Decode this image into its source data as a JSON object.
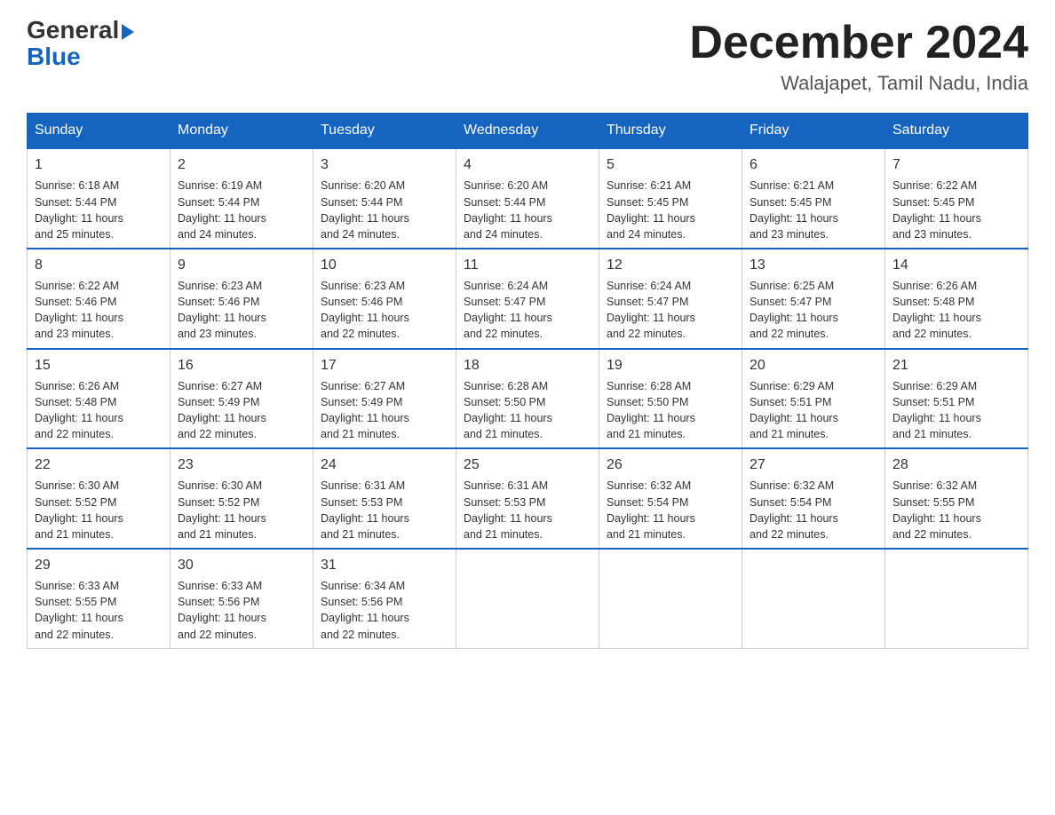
{
  "header": {
    "logo_line1": "General",
    "logo_line2": "Blue",
    "month_title": "December 2024",
    "location": "Walajapet, Tamil Nadu, India"
  },
  "days_of_week": [
    "Sunday",
    "Monday",
    "Tuesday",
    "Wednesday",
    "Thursday",
    "Friday",
    "Saturday"
  ],
  "weeks": [
    [
      {
        "day": 1,
        "info": "Sunrise: 6:18 AM\nSunset: 5:44 PM\nDaylight: 11 hours\nand 25 minutes."
      },
      {
        "day": 2,
        "info": "Sunrise: 6:19 AM\nSunset: 5:44 PM\nDaylight: 11 hours\nand 24 minutes."
      },
      {
        "day": 3,
        "info": "Sunrise: 6:20 AM\nSunset: 5:44 PM\nDaylight: 11 hours\nand 24 minutes."
      },
      {
        "day": 4,
        "info": "Sunrise: 6:20 AM\nSunset: 5:44 PM\nDaylight: 11 hours\nand 24 minutes."
      },
      {
        "day": 5,
        "info": "Sunrise: 6:21 AM\nSunset: 5:45 PM\nDaylight: 11 hours\nand 24 minutes."
      },
      {
        "day": 6,
        "info": "Sunrise: 6:21 AM\nSunset: 5:45 PM\nDaylight: 11 hours\nand 23 minutes."
      },
      {
        "day": 7,
        "info": "Sunrise: 6:22 AM\nSunset: 5:45 PM\nDaylight: 11 hours\nand 23 minutes."
      }
    ],
    [
      {
        "day": 8,
        "info": "Sunrise: 6:22 AM\nSunset: 5:46 PM\nDaylight: 11 hours\nand 23 minutes."
      },
      {
        "day": 9,
        "info": "Sunrise: 6:23 AM\nSunset: 5:46 PM\nDaylight: 11 hours\nand 23 minutes."
      },
      {
        "day": 10,
        "info": "Sunrise: 6:23 AM\nSunset: 5:46 PM\nDaylight: 11 hours\nand 22 minutes."
      },
      {
        "day": 11,
        "info": "Sunrise: 6:24 AM\nSunset: 5:47 PM\nDaylight: 11 hours\nand 22 minutes."
      },
      {
        "day": 12,
        "info": "Sunrise: 6:24 AM\nSunset: 5:47 PM\nDaylight: 11 hours\nand 22 minutes."
      },
      {
        "day": 13,
        "info": "Sunrise: 6:25 AM\nSunset: 5:47 PM\nDaylight: 11 hours\nand 22 minutes."
      },
      {
        "day": 14,
        "info": "Sunrise: 6:26 AM\nSunset: 5:48 PM\nDaylight: 11 hours\nand 22 minutes."
      }
    ],
    [
      {
        "day": 15,
        "info": "Sunrise: 6:26 AM\nSunset: 5:48 PM\nDaylight: 11 hours\nand 22 minutes."
      },
      {
        "day": 16,
        "info": "Sunrise: 6:27 AM\nSunset: 5:49 PM\nDaylight: 11 hours\nand 22 minutes."
      },
      {
        "day": 17,
        "info": "Sunrise: 6:27 AM\nSunset: 5:49 PM\nDaylight: 11 hours\nand 21 minutes."
      },
      {
        "day": 18,
        "info": "Sunrise: 6:28 AM\nSunset: 5:50 PM\nDaylight: 11 hours\nand 21 minutes."
      },
      {
        "day": 19,
        "info": "Sunrise: 6:28 AM\nSunset: 5:50 PM\nDaylight: 11 hours\nand 21 minutes."
      },
      {
        "day": 20,
        "info": "Sunrise: 6:29 AM\nSunset: 5:51 PM\nDaylight: 11 hours\nand 21 minutes."
      },
      {
        "day": 21,
        "info": "Sunrise: 6:29 AM\nSunset: 5:51 PM\nDaylight: 11 hours\nand 21 minutes."
      }
    ],
    [
      {
        "day": 22,
        "info": "Sunrise: 6:30 AM\nSunset: 5:52 PM\nDaylight: 11 hours\nand 21 minutes."
      },
      {
        "day": 23,
        "info": "Sunrise: 6:30 AM\nSunset: 5:52 PM\nDaylight: 11 hours\nand 21 minutes."
      },
      {
        "day": 24,
        "info": "Sunrise: 6:31 AM\nSunset: 5:53 PM\nDaylight: 11 hours\nand 21 minutes."
      },
      {
        "day": 25,
        "info": "Sunrise: 6:31 AM\nSunset: 5:53 PM\nDaylight: 11 hours\nand 21 minutes."
      },
      {
        "day": 26,
        "info": "Sunrise: 6:32 AM\nSunset: 5:54 PM\nDaylight: 11 hours\nand 21 minutes."
      },
      {
        "day": 27,
        "info": "Sunrise: 6:32 AM\nSunset: 5:54 PM\nDaylight: 11 hours\nand 22 minutes."
      },
      {
        "day": 28,
        "info": "Sunrise: 6:32 AM\nSunset: 5:55 PM\nDaylight: 11 hours\nand 22 minutes."
      }
    ],
    [
      {
        "day": 29,
        "info": "Sunrise: 6:33 AM\nSunset: 5:55 PM\nDaylight: 11 hours\nand 22 minutes."
      },
      {
        "day": 30,
        "info": "Sunrise: 6:33 AM\nSunset: 5:56 PM\nDaylight: 11 hours\nand 22 minutes."
      },
      {
        "day": 31,
        "info": "Sunrise: 6:34 AM\nSunset: 5:56 PM\nDaylight: 11 hours\nand 22 minutes."
      },
      null,
      null,
      null,
      null
    ]
  ]
}
